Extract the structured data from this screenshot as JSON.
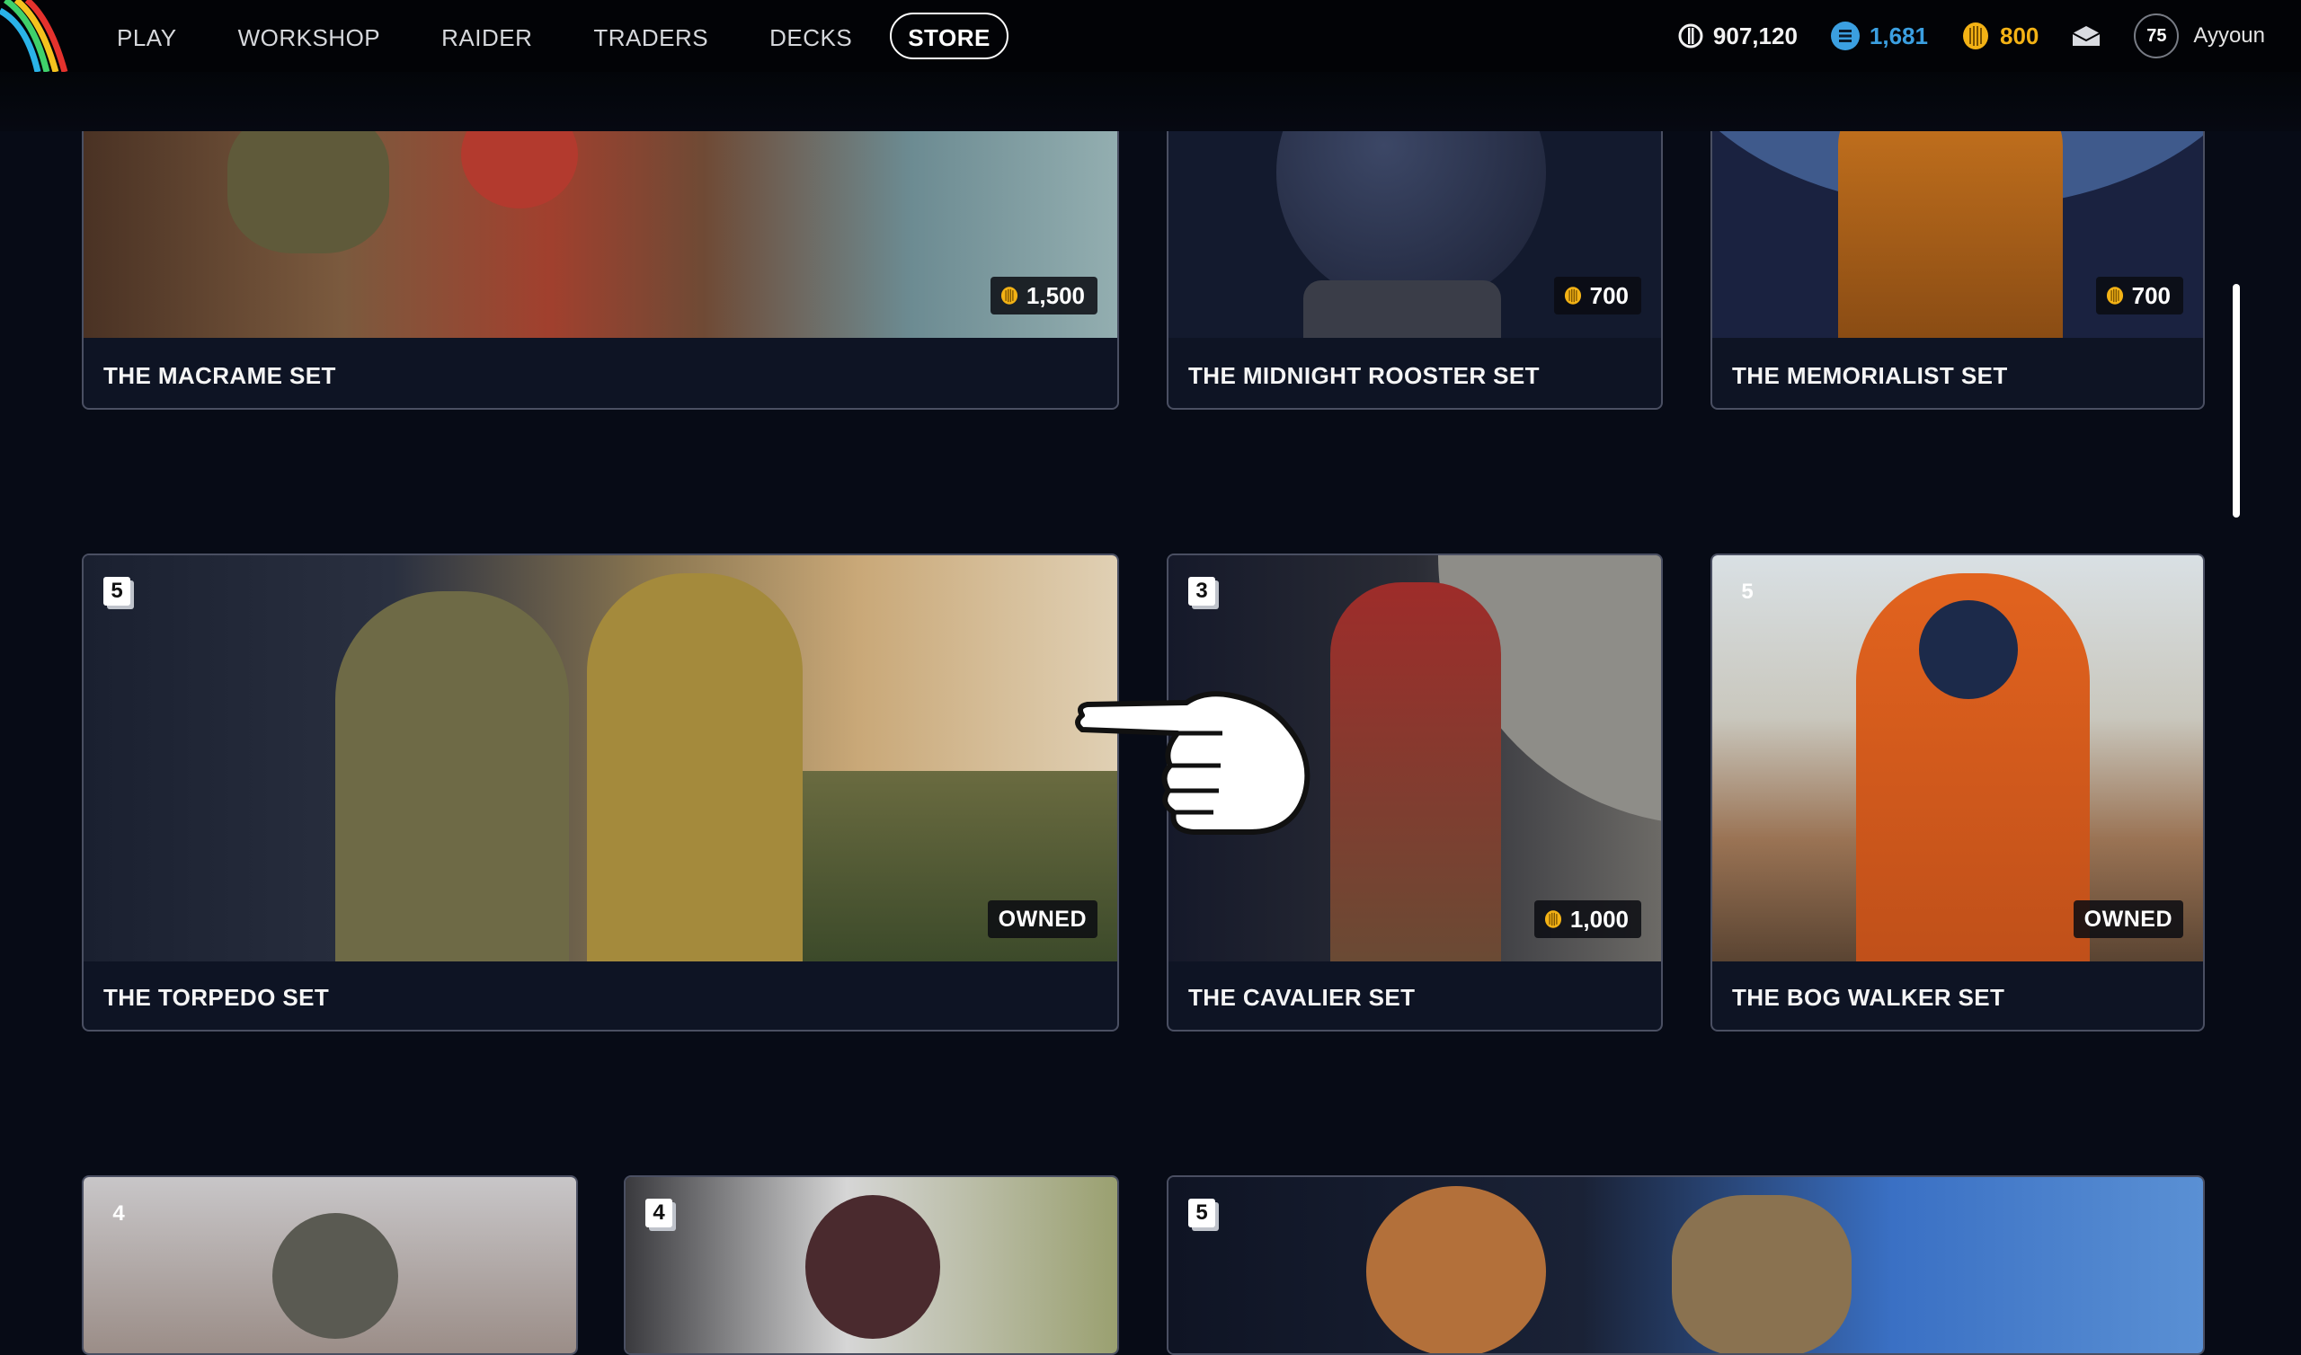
{
  "nav": {
    "items": [
      {
        "label": "PLAY",
        "active": false
      },
      {
        "label": "WORKSHOP",
        "active": false
      },
      {
        "label": "RAIDER",
        "active": false
      },
      {
        "label": "TRADERS",
        "active": false
      },
      {
        "label": "DECKS",
        "active": false
      },
      {
        "label": "STORE",
        "active": true
      }
    ]
  },
  "currencies": {
    "coins": "907,120",
    "tokens": "1,681",
    "credits": "800"
  },
  "user": {
    "level": "75",
    "name": "Ayyoun"
  },
  "icons": {
    "coin": "coin-icon",
    "token": "token-icon",
    "credit": "credit-icon",
    "mail": "mail-icon",
    "pointer": "pointing-hand-icon"
  },
  "colors": {
    "tokens": "#3b9fe0",
    "credits": "#f3b215",
    "card_border": "#4a4f62"
  },
  "cards": {
    "row1": [
      {
        "name": "THE MACRAME SET",
        "price": "1,500"
      },
      {
        "name": "THE MIDNIGHT ROOSTER SET",
        "price": "700"
      },
      {
        "name": "THE MEMORIALIST SET",
        "price": "700"
      }
    ],
    "row2": [
      {
        "name": "THE TORPEDO SET",
        "count": "5",
        "status": "OWNED"
      },
      {
        "name": "THE CAVALIER SET",
        "count": "3",
        "price": "1,000"
      },
      {
        "name": "THE BOG WALKER SET",
        "count": "5",
        "status": "OWNED"
      }
    ],
    "row3": [
      {
        "count": "4"
      },
      {
        "count": "4"
      },
      {
        "count": "5"
      }
    ]
  }
}
